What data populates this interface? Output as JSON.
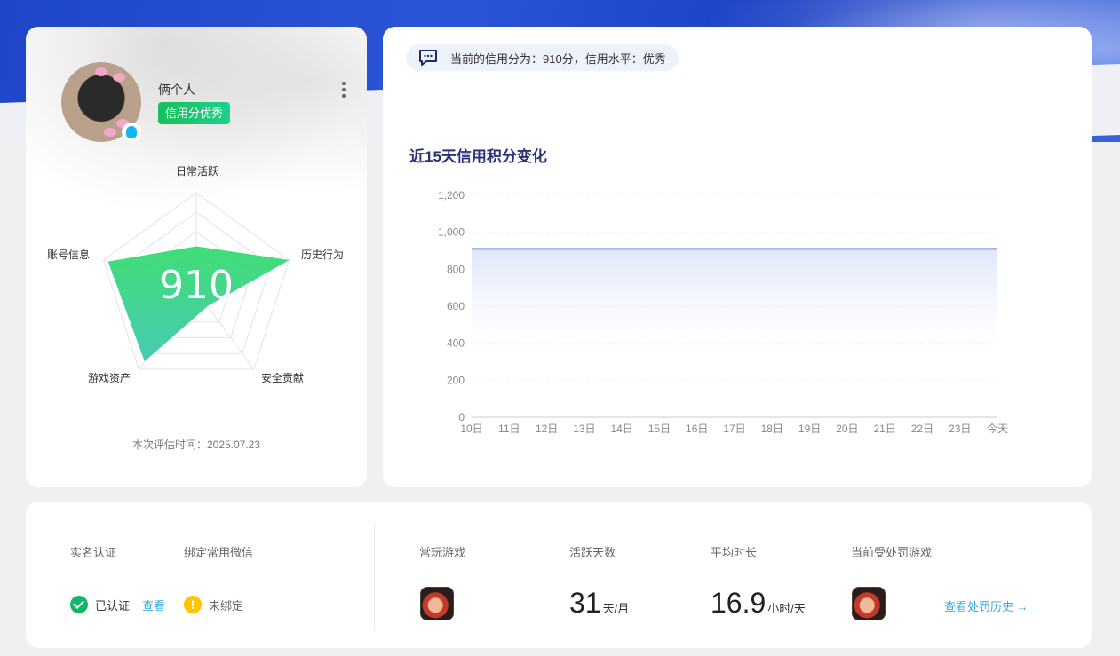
{
  "profile": {
    "username": "俩个人",
    "credit_badge": "信用分优秀",
    "score": "910",
    "radar_labels": {
      "daily_activity": "日常活跃",
      "history_behavior": "历史行为",
      "security_contribution": "安全贡献",
      "game_assets": "游戏资产",
      "account_info": "账号信息"
    },
    "radar_values": {
      "daily_activity": 0.45,
      "history_behavior": 1.0,
      "security_contribution": 0.2,
      "game_assets": 0.9,
      "account_info": 0.95
    },
    "eval_time": "本次评估时间：2025.07.23"
  },
  "notice": {
    "text": "当前的信用分为：910分，信用水平：优秀"
  },
  "chart_data": {
    "type": "area",
    "title": "近15天信用积分变化",
    "categories": [
      "10日",
      "11日",
      "12日",
      "13日",
      "14日",
      "15日",
      "16日",
      "17日",
      "18日",
      "19日",
      "20日",
      "21日",
      "22日",
      "23日",
      "今天"
    ],
    "series": [
      {
        "values": [
          910,
          910,
          910,
          910,
          910,
          910,
          910,
          910,
          910,
          910,
          910,
          910,
          910,
          910,
          910
        ]
      }
    ],
    "y_ticks": [
      "0",
      "200",
      "400",
      "600",
      "800",
      "1,000",
      "1,200"
    ],
    "ylim": [
      0,
      1200
    ],
    "line_color": "#6f8ee0",
    "fill_color": "#dfe6fb"
  },
  "bottom": {
    "real_name_label": "实名认证",
    "wechat_label": "绑定常用微信",
    "verified_text": "已认证",
    "view_link": "查看",
    "unbound_text": "未绑定",
    "frequent_game_label": "常玩游戏",
    "active_days_label": "活跃天数",
    "active_days_value": "31",
    "active_days_unit": "天/月",
    "avg_duration_label": "平均时长",
    "avg_duration_value": "16.9",
    "avg_duration_unit": "小时/天",
    "punished_game_label": "当前受处罚游戏",
    "history_link": "查看处罚历史 →"
  }
}
